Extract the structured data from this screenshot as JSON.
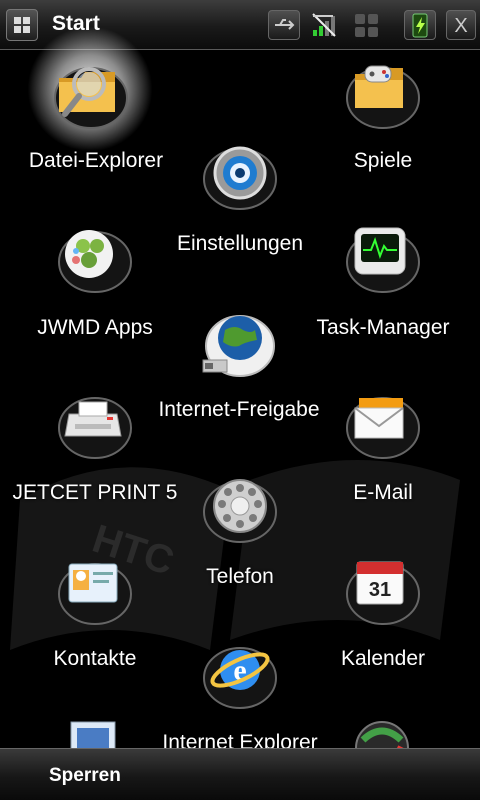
{
  "header": {
    "title": "Start",
    "icons": [
      "windows-start-icon",
      "usb-connection-icon",
      "signal-strength-icon",
      "keyboard-icon",
      "battery-charging-icon",
      "close-icon"
    ],
    "close_label": "X"
  },
  "apps": [
    {
      "id": "datei-explorer",
      "label": "Datei-Explorer",
      "icon": "folder-magnifier-icon"
    },
    {
      "id": "spiele",
      "label": "Spiele",
      "icon": "games-folder-icon"
    },
    {
      "id": "einstellungen",
      "label": "Einstellungen",
      "icon": "settings-gear-icon"
    },
    {
      "id": "jwmd-apps",
      "label": "JWMD Apps",
      "icon": "jwmd-apps-icon"
    },
    {
      "id": "task-manager",
      "label": "Task-Manager",
      "icon": "task-manager-monitor-icon"
    },
    {
      "id": "internet-freigabe",
      "label": "Internet-Freigabe",
      "icon": "globe-usb-icon"
    },
    {
      "id": "jetcet-print",
      "label": "JETCET PRINT 5",
      "icon": "printer-icon"
    },
    {
      "id": "e-mail",
      "label": "E-Mail",
      "icon": "envelope-icon"
    },
    {
      "id": "telefon",
      "label": "Telefon",
      "icon": "rotary-phone-icon"
    },
    {
      "id": "kontakte",
      "label": "Kontakte",
      "icon": "contact-card-icon"
    },
    {
      "id": "kalender",
      "label": "Kalender",
      "icon": "calendar-icon"
    },
    {
      "id": "internet-explorer",
      "label": "Internet Explorer",
      "icon": "internet-explorer-icon"
    }
  ],
  "calendar_day": "31",
  "background_logo_text": "HTC",
  "footer": {
    "left_softkey": "Sperren"
  },
  "colors": {
    "background": "#000000",
    "bar": "#2a2a2a",
    "text": "#ffffff"
  }
}
